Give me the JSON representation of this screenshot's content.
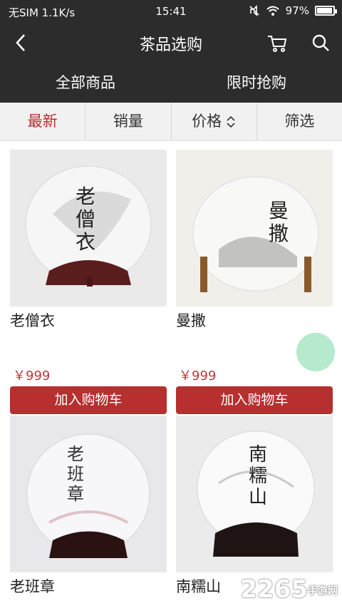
{
  "status_bar": {
    "carrier": "无SIM 1.1K/s",
    "time": "15:41",
    "battery_percent": "97%",
    "battery_level": 0.97
  },
  "nav": {
    "title": "茶品选购",
    "back_icon": "back-arrow-icon",
    "cart_icon": "cart-icon",
    "search_icon": "search-icon"
  },
  "tabs": [
    {
      "label": "全部商品"
    },
    {
      "label": "限时抢购"
    }
  ],
  "sort": {
    "newest": "最新",
    "sales": "销量",
    "price": "价格",
    "filter": "筛选",
    "active_color": "#b72f2f"
  },
  "products": [
    {
      "name": "老僧衣",
      "price": "￥999",
      "add_label": "加入购物车",
      "cake_text": "老僧衣"
    },
    {
      "name": "曼撒",
      "price": "￥999",
      "add_label": "加入购物车",
      "cake_text": "曼撒"
    },
    {
      "name": "老班章",
      "price": "",
      "add_label": "",
      "cake_text": "老班章"
    },
    {
      "name": "南糯山",
      "price": "",
      "add_label": "",
      "cake_text": "南糯山"
    }
  ],
  "watermark": {
    "brand": "2265",
    "sub": "手游网"
  }
}
